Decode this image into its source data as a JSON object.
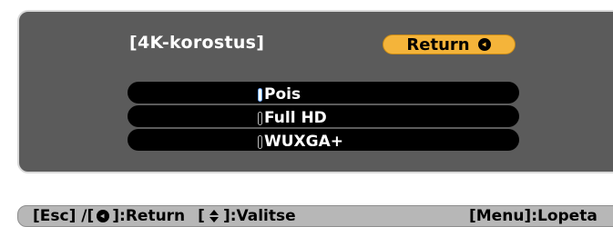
{
  "dialog": {
    "title": "[4K-korostus]",
    "return_label": "Return",
    "options": [
      {
        "label": "Pois",
        "selected": true
      },
      {
        "label": "Full HD",
        "selected": false
      },
      {
        "label": "WUXGA+",
        "selected": false
      }
    ]
  },
  "footer": {
    "esc_key": "[Esc] /[",
    "return_part": "]:Return",
    "select_open": "[",
    "select_part": "]:Valitse",
    "menu_part": "[Menu]:Lopeta"
  },
  "icons": {
    "enter": "enter-icon",
    "updown": "up-down-icon"
  },
  "colors": {
    "dialog_bg": "#5b5b5b",
    "return_button": "#f4b43a",
    "selected_radio": "#6aa7ff",
    "footer_bg": "#b7b7b7"
  }
}
